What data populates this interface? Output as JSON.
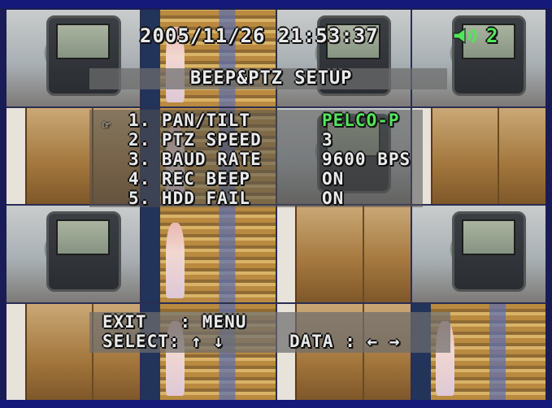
{
  "osd": {
    "datetime": "2005/11/26 21:53:37",
    "channel": "2",
    "channel_icon": "speaker-icon",
    "accent_green": "#51e55a"
  },
  "setup": {
    "title": "BEEP&PTZ SETUP",
    "cursor": "☞",
    "items": [
      {
        "label": "1. PAN/TILT",
        "value": "PELCO-P"
      },
      {
        "label": "2. PTZ SPEED",
        "value": "3"
      },
      {
        "label": "3. BAUD RATE",
        "value": "9600 BPS"
      },
      {
        "label": "4. REC BEEP",
        "value": "ON"
      },
      {
        "label": "5. HDD FAIL",
        "value": "ON"
      }
    ]
  },
  "footer": {
    "exit_label": "EXIT   : MENU",
    "select_label": "SELECT: ↑ ↓",
    "data_label": "DATA : ← →"
  }
}
